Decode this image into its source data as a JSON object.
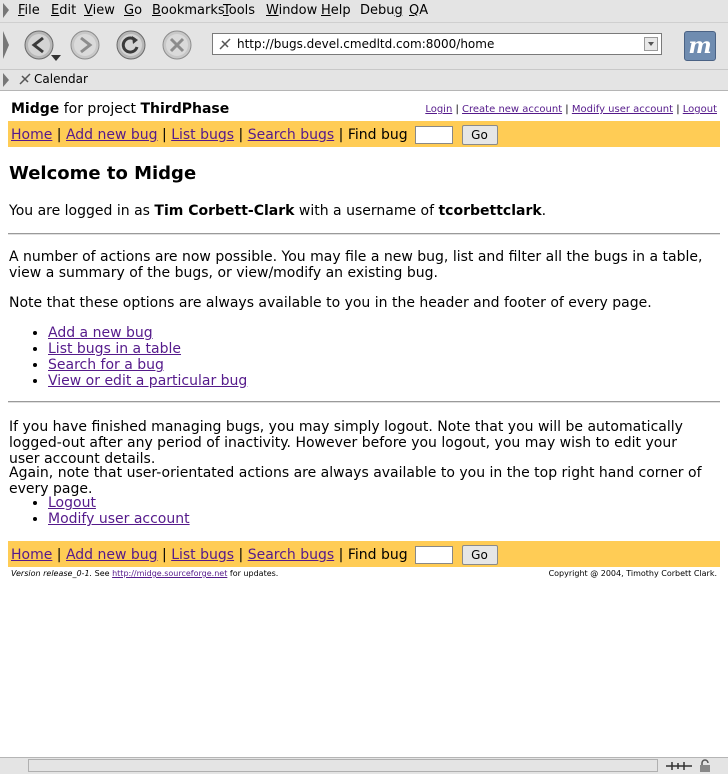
{
  "browser": {
    "menu": [
      "File",
      "Edit",
      "View",
      "Go",
      "Bookmarks",
      "Tools",
      "Window",
      "Help",
      "Debug",
      "QA"
    ],
    "menu_underline": [
      "F",
      "E",
      "V",
      "G",
      "B",
      "T",
      "W",
      "H",
      "g",
      "Q"
    ],
    "url": "http://bugs.devel.cmedltd.com:8000/home",
    "personal_bookmark": "Calendar",
    "throbber_letter": "m"
  },
  "header": {
    "app_name": "Midge",
    "for_project": "for project",
    "project_name": "ThirdPhase",
    "account_links": [
      "Login",
      "Create new account",
      "Modify user account",
      "Logout"
    ]
  },
  "navbar": {
    "home": "Home",
    "add": "Add new bug",
    "list": "List bugs",
    "search": "Search bugs",
    "find_label": "Find bug",
    "go": "Go",
    "find_value": ""
  },
  "main": {
    "title": "Welcome to Midge",
    "logged_in_prefix": "You are logged in as",
    "full_name": "Tim Corbett-Clark",
    "username_mid": "with a username of",
    "username": "tcorbettclark",
    "username_suffix": ".",
    "actions_intro": "A number of actions are now possible. You may file a new bug, list and filter all the bugs in a table, view a summary of the bugs, or view/modify an existing bug.",
    "options_note": "Note that these options are always available to you in the header and footer of every page.",
    "action_links": [
      "Add a new bug",
      "List bugs in a table",
      "Search for a bug",
      "View or edit a particular bug"
    ],
    "logout_intro": "If you have finished managing bugs, you may simply logout. Note that you will be automatically logged-out after any period of inactivity. However before you logout, you may wish to edit your user account details.",
    "user_note": "Again, note that user-orientated actions are always available to you in the top right hand corner of every page.",
    "user_links": [
      "Logout",
      "Modify user account"
    ]
  },
  "footer": {
    "version": "Version release_0-1.",
    "see": "See",
    "site_link": "http://midge.sourceforge.net",
    "for_updates": "for updates.",
    "copyright": "Copyright @ 2004, Timothy Corbett Clark."
  }
}
